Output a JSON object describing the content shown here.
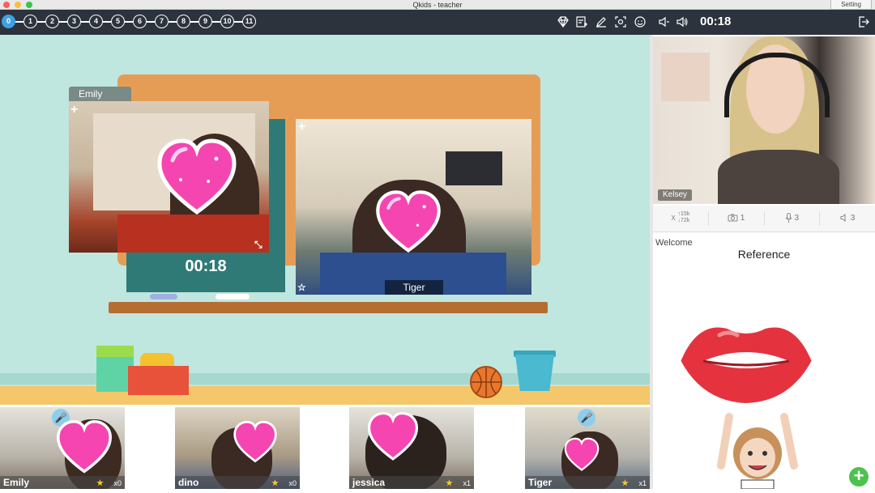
{
  "window": {
    "title": "Qkids - teacher",
    "setting_label": "Setting"
  },
  "toolbar": {
    "steps": [
      "0",
      "1",
      "2",
      "3",
      "4",
      "5",
      "6",
      "7",
      "8",
      "9",
      "10",
      "11"
    ],
    "active_step": "0",
    "timer": "00:18",
    "tools": [
      "diamond-icon",
      "note-add-icon",
      "pen-icon",
      "screenshot-icon",
      "smile-icon",
      "volume-down-icon",
      "volume-up-icon"
    ],
    "exit_icon": "exit-icon"
  },
  "stage": {
    "student_feed_name": "Emily",
    "timer": "00:18",
    "partner_feed_name": "Tiger",
    "colors": {
      "background": "#bfe6df",
      "board": "#e59d55",
      "chalkboard": "#2f7a77",
      "floor": "#f4c86a"
    }
  },
  "teacher_panel": {
    "name": "Kelsey",
    "stats": {
      "net_up": "15k",
      "net_down": "72k",
      "camera": "1",
      "mic": "3",
      "speaker": "3"
    },
    "welcome": "Welcome",
    "reference": "Reference"
  },
  "students": [
    {
      "name": "Emily",
      "count": "x0",
      "mic_active": true
    },
    {
      "name": "dino",
      "count": "x0",
      "mic_active": false
    },
    {
      "name": "jessica",
      "count": "x1",
      "mic_active": false
    },
    {
      "name": "Tiger",
      "count": "x1",
      "mic_active": true
    }
  ]
}
